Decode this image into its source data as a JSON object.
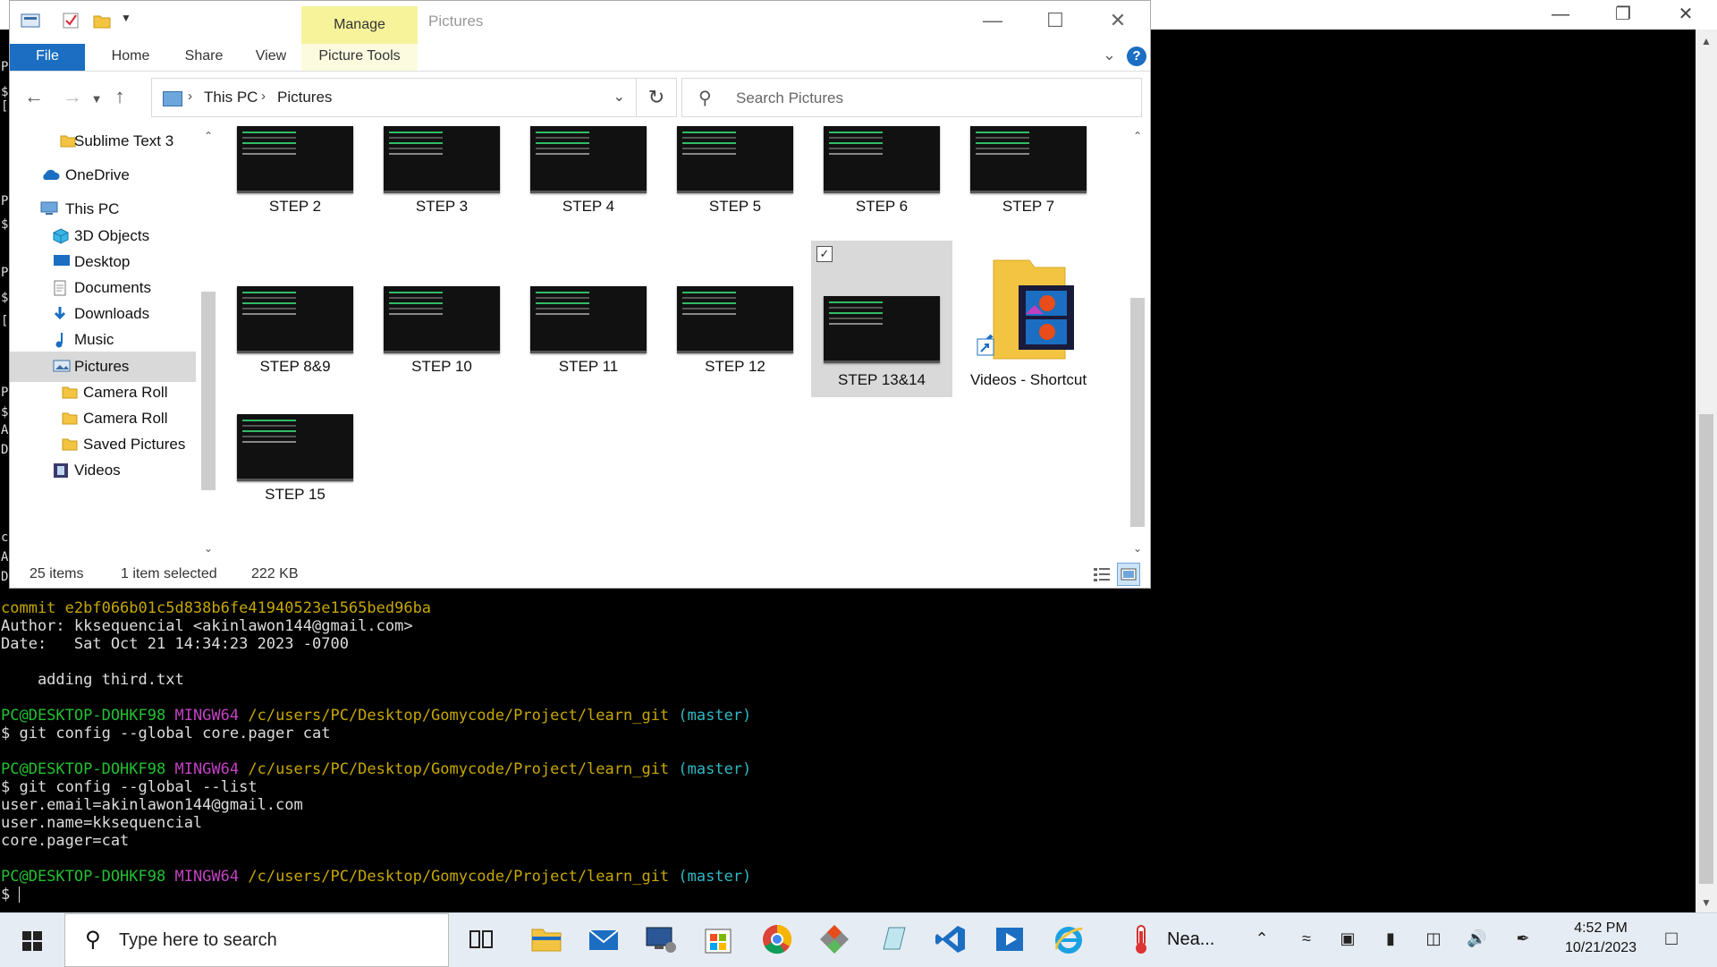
{
  "terminal": {
    "left_strip": [
      "P",
      "$",
      "[",
      "P",
      "$",
      "P",
      "$",
      "[",
      "P",
      "$",
      "A",
      "D",
      "c",
      "A",
      "D"
    ],
    "lines": [
      {
        "segments": [
          {
            "text": "commit e2bf066b01c5d838b6fe41940523e1565bed96ba",
            "color": "yellow"
          }
        ]
      },
      {
        "segments": [
          {
            "text": "Author: kksequencial <akinlawon144@gmail.com>",
            "color": "default"
          }
        ]
      },
      {
        "segments": [
          {
            "text": "Date:   Sat Oct 21 14:34:23 2023 -0700",
            "color": "default"
          }
        ]
      },
      {
        "segments": [
          {
            "text": "",
            "color": "default"
          }
        ]
      },
      {
        "segments": [
          {
            "text": "    adding third.txt",
            "color": "default"
          }
        ]
      },
      {
        "segments": [
          {
            "text": "",
            "color": "default"
          }
        ]
      },
      {
        "segments": [
          {
            "text": "PC@DESKTOP-DOHKF98 ",
            "color": "green"
          },
          {
            "text": "MINGW64 ",
            "color": "magenta"
          },
          {
            "text": "/c/users/PC/Desktop/Gomycode/Project/learn_git ",
            "color": "yellow"
          },
          {
            "text": "(master)",
            "color": "cyan"
          }
        ]
      },
      {
        "segments": [
          {
            "text": "$ git config --global core.pager cat",
            "color": "default"
          }
        ]
      },
      {
        "segments": [
          {
            "text": "",
            "color": "default"
          }
        ]
      },
      {
        "segments": [
          {
            "text": "PC@DESKTOP-DOHKF98 ",
            "color": "green"
          },
          {
            "text": "MINGW64 ",
            "color": "magenta"
          },
          {
            "text": "/c/users/PC/Desktop/Gomycode/Project/learn_git ",
            "color": "yellow"
          },
          {
            "text": "(master)",
            "color": "cyan"
          }
        ]
      },
      {
        "segments": [
          {
            "text": "$ git config --global --list",
            "color": "default"
          }
        ]
      },
      {
        "segments": [
          {
            "text": "user.email=akinlawon144@gmail.com",
            "color": "default"
          }
        ]
      },
      {
        "segments": [
          {
            "text": "user.name=kksequencial",
            "color": "default"
          }
        ]
      },
      {
        "segments": [
          {
            "text": "core.pager=cat",
            "color": "default"
          }
        ]
      },
      {
        "segments": [
          {
            "text": "",
            "color": "default"
          }
        ]
      },
      {
        "segments": [
          {
            "text": "PC@DESKTOP-DOHKF98 ",
            "color": "green"
          },
          {
            "text": "MINGW64 ",
            "color": "magenta"
          },
          {
            "text": "/c/users/PC/Desktop/Gomycode/Project/learn_git ",
            "color": "yellow"
          },
          {
            "text": "(master)",
            "color": "cyan"
          }
        ]
      },
      {
        "segments": [
          {
            "text": "$ ",
            "color": "default"
          }
        ],
        "cursor": true
      }
    ]
  },
  "explorer": {
    "title": "Pictures",
    "manage_tab": "Manage",
    "ribbon_tabs": [
      "File",
      "Home",
      "Share",
      "View",
      "Picture Tools"
    ],
    "help_label": "?",
    "breadcrumb": [
      "This PC",
      "Pictures"
    ],
    "search_placeholder": "Search Pictures",
    "nav_items": [
      {
        "label": "Sublime Text 3",
        "icon": "folder-icon"
      },
      {
        "label": "OneDrive",
        "icon": "onedrive-cloud-icon"
      },
      {
        "label": "This PC",
        "icon": "computer-icon"
      },
      {
        "label": "3D Objects",
        "icon": "cube-3d-icon"
      },
      {
        "label": "Desktop",
        "icon": "desktop-icon"
      },
      {
        "label": "Documents",
        "icon": "documents-icon"
      },
      {
        "label": "Downloads",
        "icon": "download-arrow-icon"
      },
      {
        "label": "Music",
        "icon": "music-note-icon"
      },
      {
        "label": "Pictures",
        "icon": "pictures-icon",
        "selected": true
      },
      {
        "label": "Camera Roll",
        "icon": "folder-icon"
      },
      {
        "label": "Camera Roll",
        "icon": "folder-icon"
      },
      {
        "label": "Saved Pictures",
        "icon": "folder-icon"
      },
      {
        "label": "Videos",
        "icon": "videos-icon"
      }
    ],
    "files": [
      {
        "name": "STEP 2"
      },
      {
        "name": "STEP 3"
      },
      {
        "name": "STEP 4"
      },
      {
        "name": "STEP 5"
      },
      {
        "name": "STEP 6"
      },
      {
        "name": "STEP 7"
      },
      {
        "name": "STEP 8&9"
      },
      {
        "name": "STEP 10"
      },
      {
        "name": "STEP 11"
      },
      {
        "name": "STEP 12"
      },
      {
        "name": "STEP 13&14",
        "selected": true
      },
      {
        "name": "Videos - Shortcut",
        "type": "shortcut"
      },
      {
        "name": "STEP 15"
      }
    ],
    "status": {
      "items": "25 items",
      "selection": "1 item selected",
      "size": "222 KB"
    }
  },
  "taskbar": {
    "search_placeholder": "Type here to search",
    "weather_label": "Nea...",
    "time": "4:52 PM",
    "date": "10/21/2023",
    "apps": [
      "task-view-icon",
      "file-explorer-icon",
      "mail-icon",
      "remote-desktop-icon",
      "microsoft-store-icon",
      "chrome-icon",
      "git-gui-icon",
      "notepad-icon",
      "vscode-icon",
      "media-player-icon",
      "internet-explorer-icon"
    ]
  },
  "colors": {
    "accent": "#1b6ec2",
    "manage_tab": "#f7f39b",
    "terminal_bg": "#000000",
    "prompt_green": "#22c032",
    "prompt_magenta": "#c242c2",
    "path_yellow": "#c6a700",
    "branch_cyan": "#2fb8c4"
  }
}
